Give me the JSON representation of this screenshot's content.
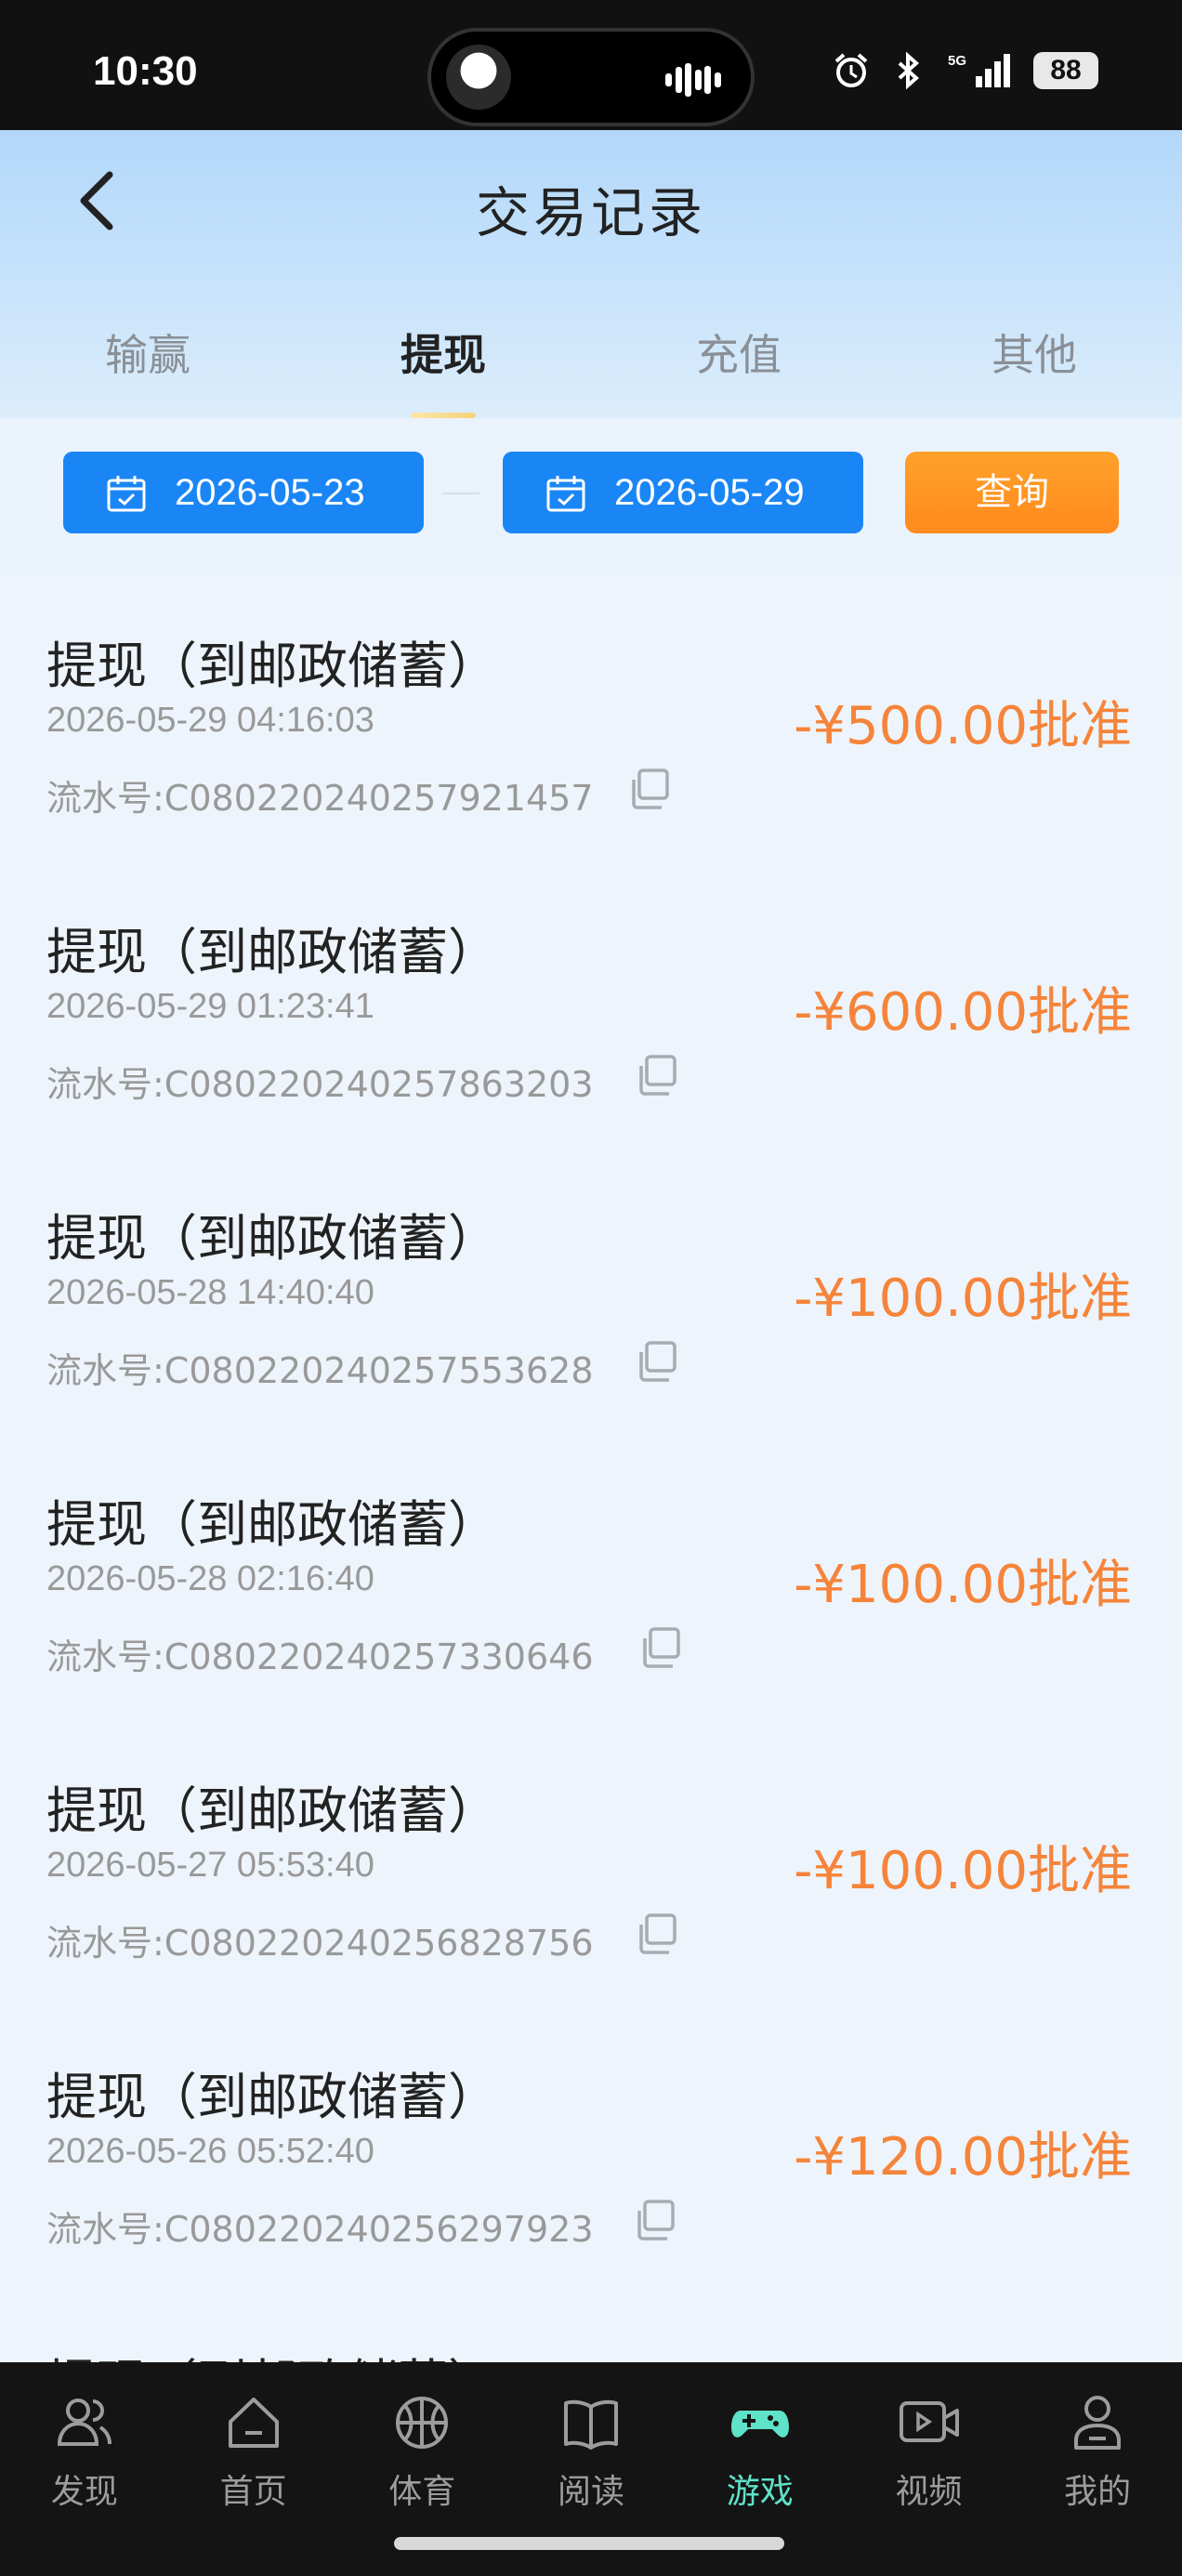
{
  "status_bar": {
    "time": "10:30",
    "network": "5G",
    "battery": "88"
  },
  "header": {
    "title": "交易记录",
    "back_icon": "chevron-left-icon"
  },
  "tabs": [
    {
      "label": "输赢",
      "active": false
    },
    {
      "label": "提现",
      "active": true
    },
    {
      "label": "充值",
      "active": false
    },
    {
      "label": "其他",
      "active": false
    }
  ],
  "filter": {
    "start_date": "2026-05-23",
    "end_date": "2026-05-29",
    "query_label": "查询"
  },
  "records": [
    {
      "title": "提现（到邮政储蓄）",
      "time": "2026-05-29 04:16:03",
      "serial": "流水号:C080220240257921457",
      "amount": "-¥500.00批准"
    },
    {
      "title": "提现（到邮政储蓄）",
      "time": "2026-05-29 01:23:41",
      "serial": "流水号:C080220240257863203",
      "amount": "-¥600.00批准"
    },
    {
      "title": "提现（到邮政储蓄）",
      "time": "2026-05-28 14:40:40",
      "serial": "流水号:C080220240257553628",
      "amount": "-¥100.00批准"
    },
    {
      "title": "提现（到邮政储蓄）",
      "time": "2026-05-28 02:16:40",
      "serial": "流水号:C080220240257330646",
      "amount": "-¥100.00批准"
    },
    {
      "title": "提现（到邮政储蓄）",
      "time": "2026-05-27 05:53:40",
      "serial": "流水号:C080220240256828756",
      "amount": "-¥100.00批准"
    },
    {
      "title": "提现（到邮政储蓄）",
      "time": "2026-05-26 05:52:40",
      "serial": "流水号:C080220240256297923",
      "amount": "-¥120.00批准"
    },
    {
      "title": "提现（到邮政储蓄）",
      "time": "",
      "serial": "",
      "amount": ""
    }
  ],
  "bottom_nav": [
    {
      "label": "发现",
      "icon": "users-icon",
      "active": false
    },
    {
      "label": "首页",
      "icon": "home-icon",
      "active": false
    },
    {
      "label": "体育",
      "icon": "basketball-icon",
      "active": false
    },
    {
      "label": "阅读",
      "icon": "book-icon",
      "active": false
    },
    {
      "label": "游戏",
      "icon": "gamepad-icon",
      "active": true
    },
    {
      "label": "视频",
      "icon": "video-icon",
      "active": false
    },
    {
      "label": "我的",
      "icon": "profile-icon",
      "active": false
    }
  ],
  "colors": {
    "accent_blue": "#1a86f5",
    "query_orange": "#ff8a1d",
    "amount_orange": "#f5843a",
    "nav_active": "#5ee2c8"
  }
}
